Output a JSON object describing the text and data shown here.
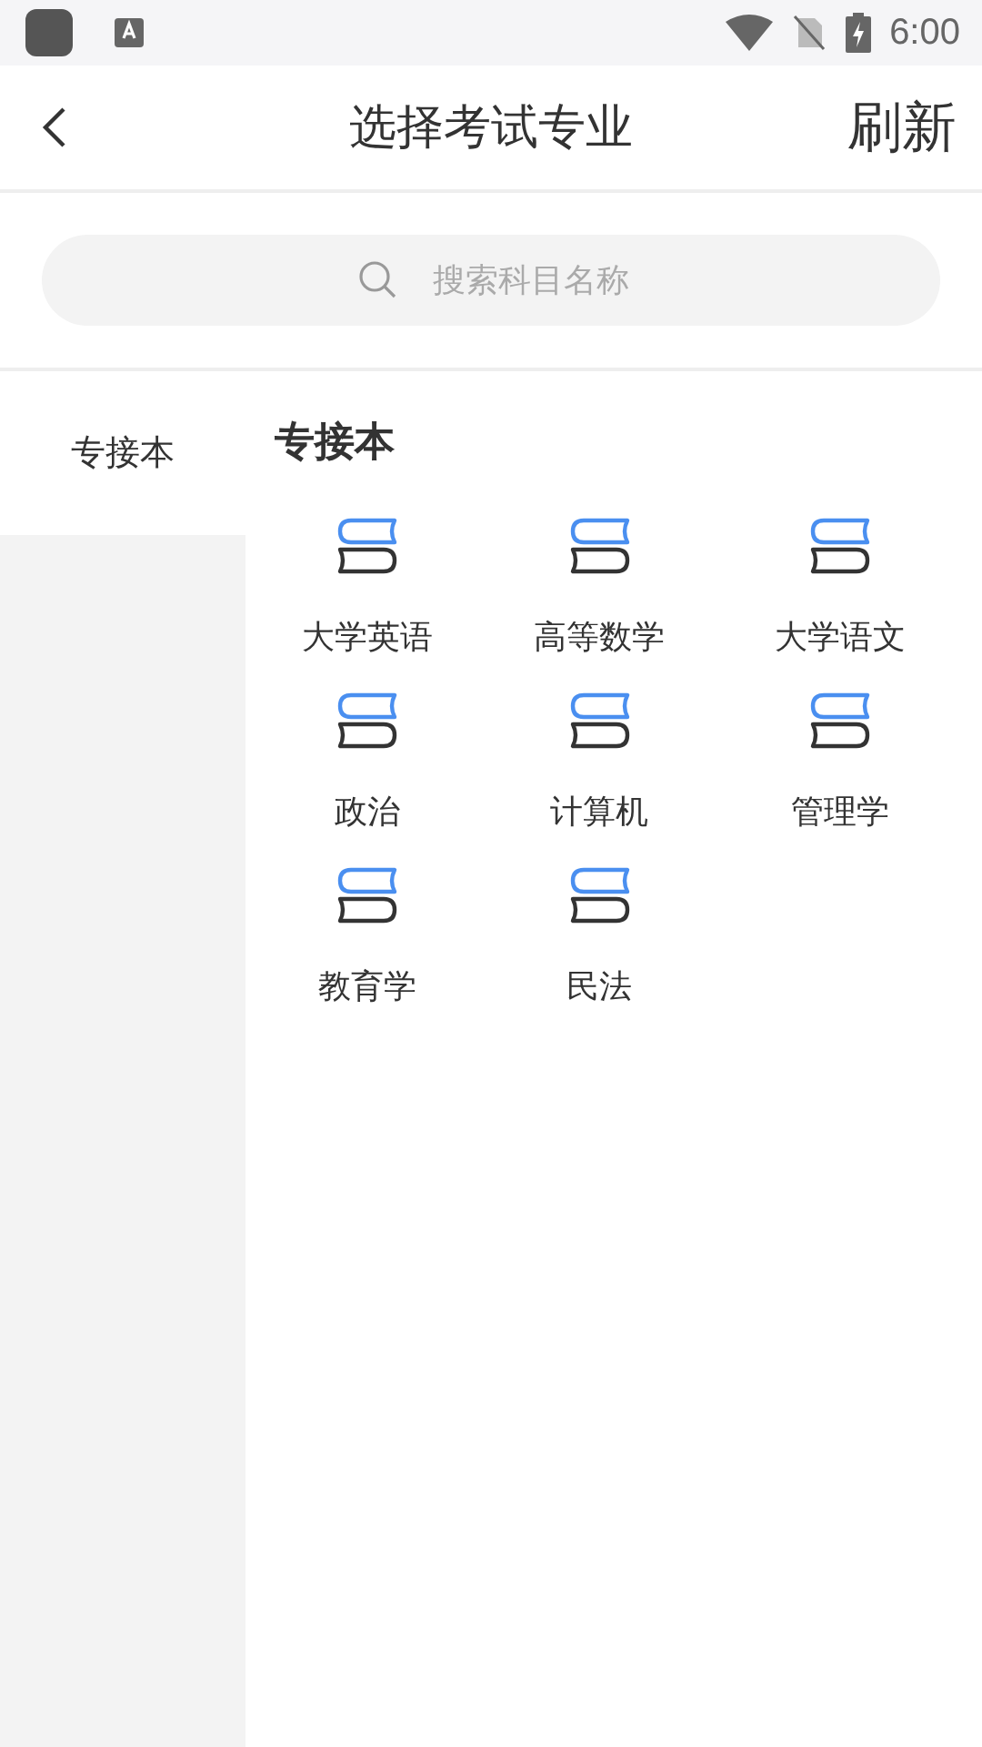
{
  "status_bar": {
    "time": "6:00"
  },
  "header": {
    "title": "选择考试专业",
    "action": "刷新"
  },
  "search": {
    "placeholder": "搜索科目名称"
  },
  "sidebar": {
    "items": [
      {
        "label": "专接本",
        "selected": true
      }
    ]
  },
  "section": {
    "title": "专接本",
    "subjects": [
      {
        "label": "大学英语"
      },
      {
        "label": "高等数学"
      },
      {
        "label": "大学语文"
      },
      {
        "label": "政治"
      },
      {
        "label": "计算机"
      },
      {
        "label": "管理学"
      },
      {
        "label": "教育学"
      },
      {
        "label": "民法"
      }
    ]
  }
}
